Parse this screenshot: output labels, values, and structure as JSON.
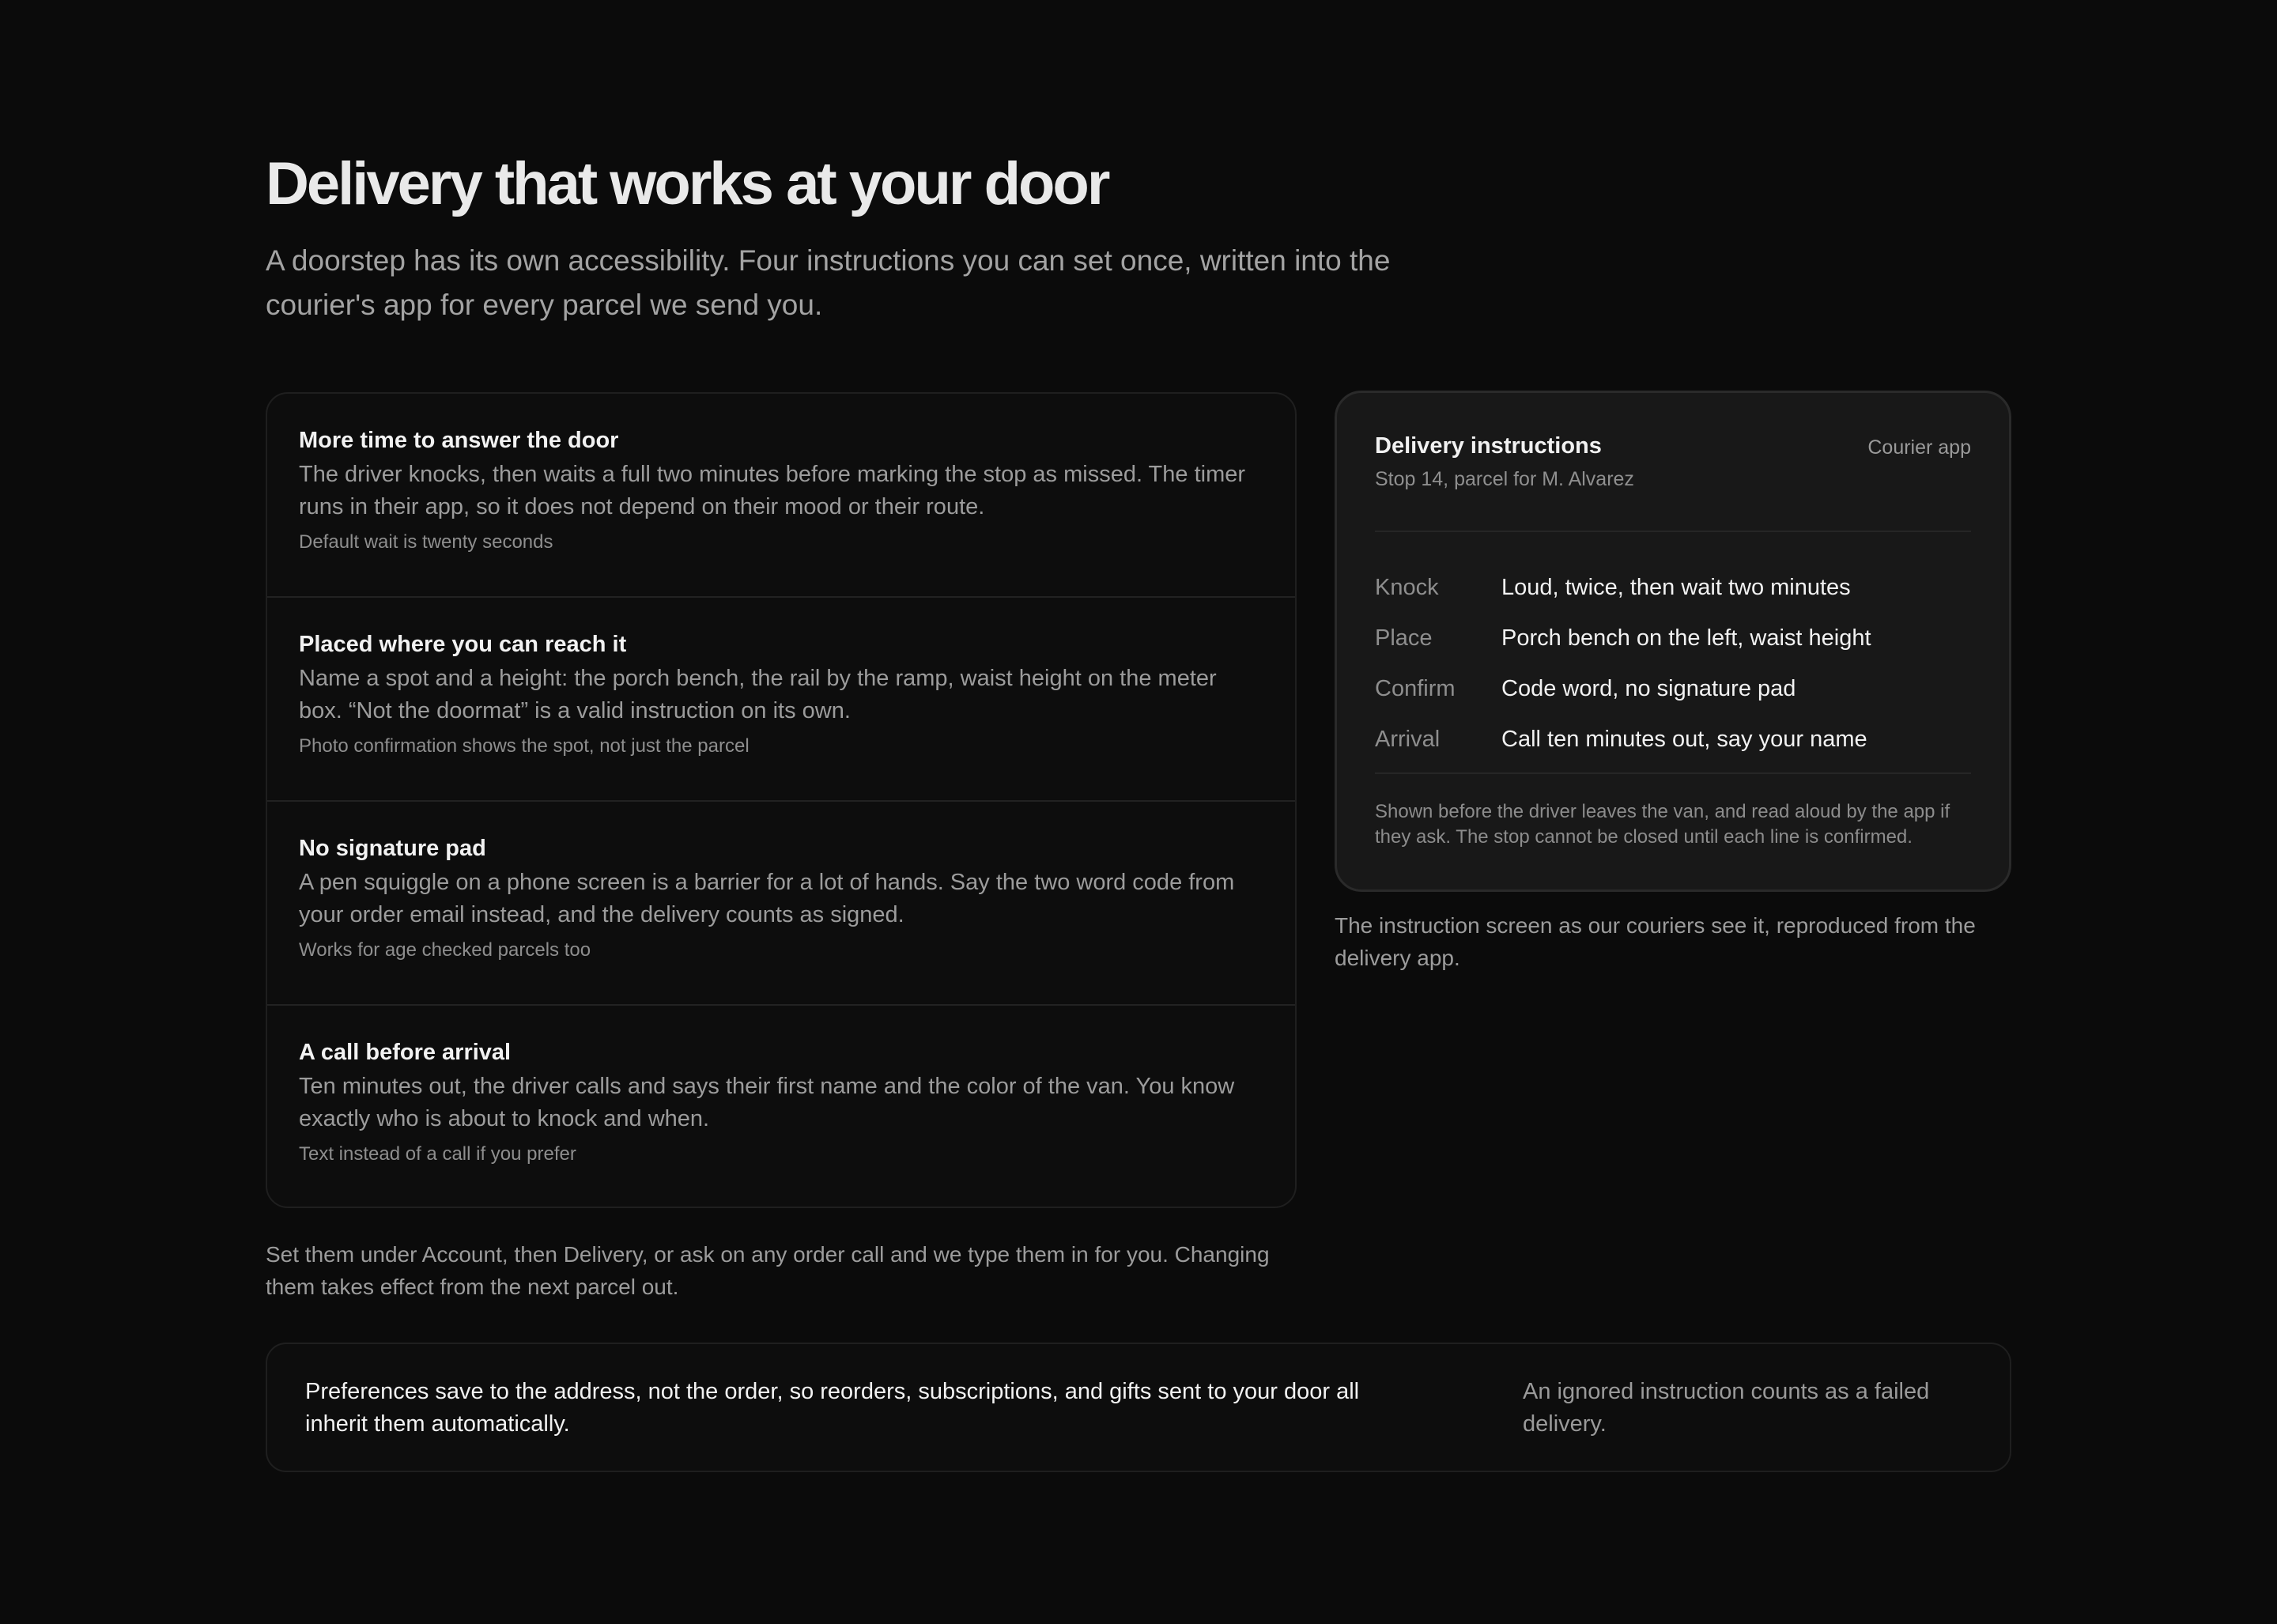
{
  "header": {
    "title": "Delivery that works at your door",
    "subtitle": "A doorstep has its own accessibility. Four instructions you can set once, written into the courier's app for every parcel we send you."
  },
  "features": [
    {
      "title": "More time to answer the door",
      "body": "The driver knocks, then waits a full two minutes before marking the stop as missed. The timer runs in their app, so it does not depend on their mood or their route.",
      "note": "Default wait is twenty seconds"
    },
    {
      "title": "Placed where you can reach it",
      "body": "Name a spot and a height: the porch bench, the rail by the ramp, waist height on the meter box. “Not the doormat” is a valid instruction on its own.",
      "note": "Photo confirmation shows the spot, not just the parcel"
    },
    {
      "title": "No signature pad",
      "body": "A pen squiggle on a phone screen is a barrier for a lot of hands. Say the two word code from your order email instead, and the delivery counts as signed.",
      "note": "Works for age checked parcels too"
    },
    {
      "title": "A call before arrival",
      "body": "Ten minutes out, the driver calls and says their first name and the color of the van. You know exactly who is about to knock and when.",
      "note": "Text instead of a call if you prefer"
    }
  ],
  "after_list": "Set them under Account, then Delivery, or ask on any order call and we type them in for you. Changing them takes effect from the next parcel out.",
  "app_card": {
    "title": "Delivery instructions",
    "tag": "Courier app",
    "subtitle": "Stop 14, parcel for M. Alvarez",
    "rows": [
      {
        "label": "Knock",
        "value": "Loud, twice, then wait two minutes"
      },
      {
        "label": "Place",
        "value": "Porch bench on the left, waist height"
      },
      {
        "label": "Confirm",
        "value": "Code word, no signature pad"
      },
      {
        "label": "Arrival",
        "value": "Call ten minutes out, say your name"
      }
    ],
    "footer": "Shown before the driver leaves the van, and read aloud by the app if they ask. The stop cannot be closed until each line is confirmed.",
    "caption": "The instruction screen as our couriers see it, reproduced from the delivery app."
  },
  "banner": {
    "main": "Preferences save to the address, not the order, so reorders, subscriptions, and gifts sent to your door all inherit them automatically.",
    "side": "An ignored instruction counts as a failed delivery."
  }
}
